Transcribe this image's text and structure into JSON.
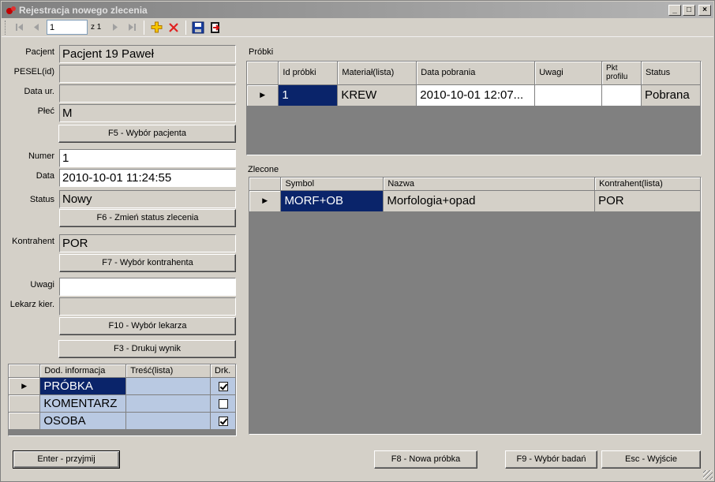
{
  "window": {
    "title": "Rejestracja nowego zlecenia"
  },
  "toolbar": {
    "record_value": "1",
    "of_label": "z 1"
  },
  "patient": {
    "label_pacjent": "Pacjent",
    "pacjent": "Pacjent 19 Paweł",
    "label_pesel": "PESEL(id)",
    "pesel": "",
    "label_data_ur": "Data ur.",
    "data_ur": "",
    "label_plec": "Płeć",
    "plec": "M",
    "btn_wybor": "F5 - Wybór pacjenta"
  },
  "order": {
    "label_numer": "Numer",
    "numer": "1",
    "label_data": "Data",
    "data": "2010-10-01 11:24:55",
    "label_status": "Status",
    "status": "Nowy",
    "btn_status": "F6 - Zmień status zlecenia"
  },
  "contractor": {
    "label": "Kontrahent",
    "value": "POR",
    "btn": "F7 - Wybór kontrahenta"
  },
  "notes": {
    "label_uwagi": "Uwagi",
    "uwagi": "",
    "label_lekarz": "Lekarz kier.",
    "lekarz": "",
    "btn_lekarz": "F10 - Wybór lekarza",
    "btn_drukuj": "F3 - Drukuj wynik"
  },
  "info_grid": {
    "headers": [
      "Dod. informacja",
      "Treść(lista)",
      "Drk."
    ],
    "rows": [
      {
        "name": "PRÓBKA",
        "tresc": "",
        "checked": true
      },
      {
        "name": "KOMENTARZ",
        "tresc": "",
        "checked": false
      },
      {
        "name": "OSOBA",
        "tresc": "",
        "checked": true
      }
    ]
  },
  "samples": {
    "label": "Próbki",
    "headers": [
      "Id próbki",
      "Materiał(lista)",
      "Data pobrania",
      "Uwagi",
      "Pkt profilu",
      "Status"
    ],
    "rows": [
      {
        "id": "1",
        "material": "KREW",
        "data": "2010-10-01 12:07...",
        "uwagi": "",
        "pkt": "",
        "status": "Pobrana"
      }
    ]
  },
  "ordered": {
    "label": "Zlecone",
    "headers": [
      "Symbol",
      "Nazwa",
      "Kontrahent(lista)"
    ],
    "rows": [
      {
        "symbol": "MORF+OB",
        "nazwa": "Morfologia+opad",
        "kontrahent": "POR"
      }
    ]
  },
  "footer": {
    "btn_enter": "Enter - przyjmij",
    "btn_nowa": "F8 - Nowa próbka",
    "btn_badania": "F9 - Wybór badań",
    "btn_wyjscie": "Esc - Wyjście"
  }
}
